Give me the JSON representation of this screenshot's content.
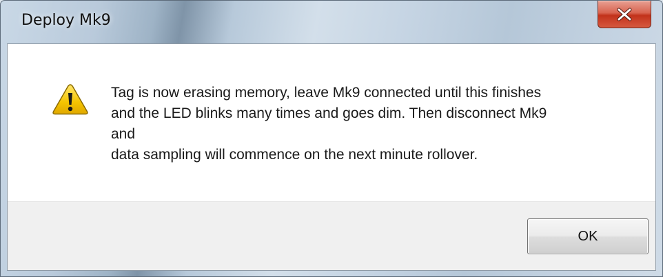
{
  "window": {
    "title": "Deploy Mk9"
  },
  "message": {
    "icon": "warning-icon",
    "lines": [
      "Tag is now erasing memory, leave Mk9 connected until this finishes",
      "and the LED blinks many times and goes dim.  Then disconnect Mk9",
      "and",
      "data sampling will commence on the next minute rollover."
    ]
  },
  "buttons": {
    "ok_label": "OK"
  },
  "colors": {
    "close_button": "#c2321b",
    "warning_fill": "#f5c400",
    "content_bg": "#ffffff",
    "button_area_bg": "#f0f0f0"
  }
}
